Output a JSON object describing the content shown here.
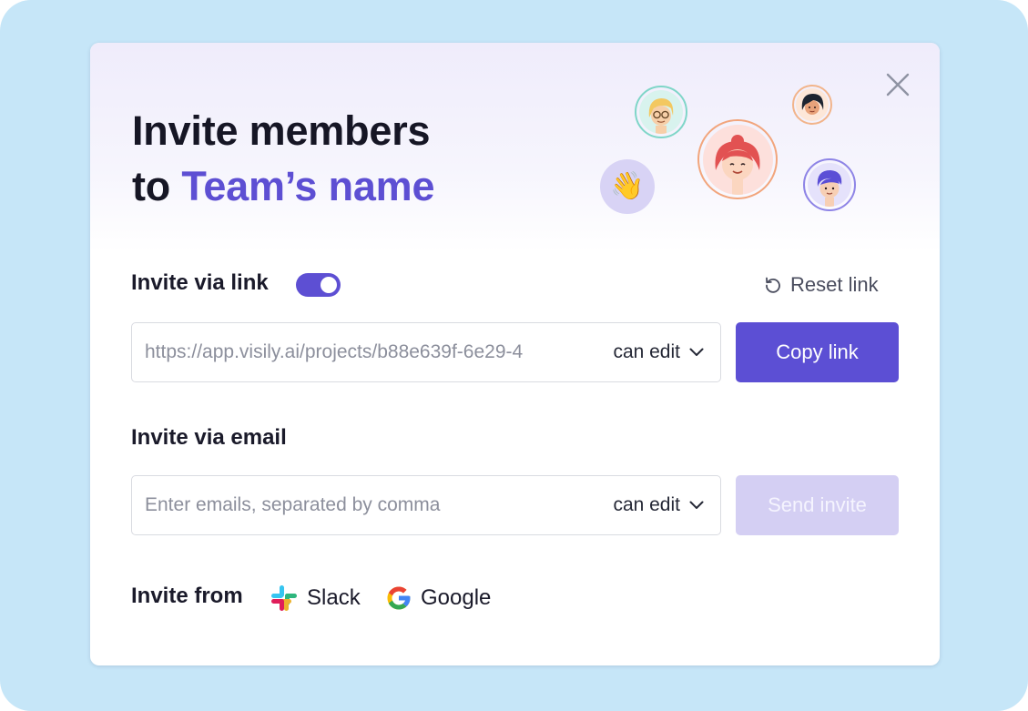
{
  "dialog": {
    "title_line1": "Invite members",
    "title_prefix": "to ",
    "team_name": "Team’s name",
    "close_icon": "close-icon"
  },
  "link_section": {
    "label": "Invite via link",
    "toggle_on": true,
    "reset_label": "Reset link",
    "reset_icon": "reset-icon",
    "url": "https://app.visily.ai/projects/b88e639f-6e29-4",
    "permission": "can edit",
    "copy_label": "Copy link"
  },
  "email_section": {
    "label": "Invite via email",
    "placeholder": "Enter emails, separated by comma",
    "permission": "can edit",
    "send_label": "Send invite",
    "send_disabled": true
  },
  "invite_from": {
    "label": "Invite from",
    "providers": [
      {
        "name": "Slack",
        "icon": "slack-icon"
      },
      {
        "name": "Google",
        "icon": "google-icon"
      }
    ]
  },
  "colors": {
    "accent": "#5d4fd3",
    "frame": "#c6e6f8",
    "disabled_button": "#d4cff3"
  },
  "decor": {
    "emoji": "👋",
    "avatars": [
      "avatar-glasses",
      "avatar-redhead",
      "avatar-dark-hair",
      "avatar-blue-hair",
      "wave-emoji"
    ]
  }
}
